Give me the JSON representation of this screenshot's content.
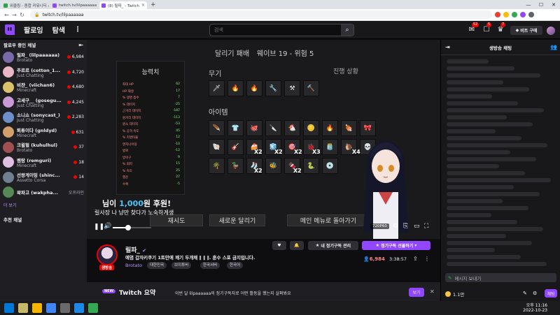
{
  "browser": {
    "tabs": [
      {
        "label": "위클링 - 종합 커뮤니티 스포티파이",
        "color": "#2ea44f"
      },
      {
        "label": "twitch.tv/lilpaaaaaa",
        "color": "#9147ff"
      },
      {
        "label": "(8) 릴파_ - Twitch",
        "color": "#9147ff",
        "active": true
      }
    ],
    "new_tab": "+",
    "url": "twitch.tv/lilpaaaaaa",
    "minimize": "—",
    "maximize": "☐",
    "close": "✕"
  },
  "nav": {
    "following": "팔로잉",
    "browse": "탐색",
    "more": "⋮",
    "search_placeholder": "검색",
    "search_icon": "⌕",
    "notif_count_1": "52",
    "notif_count_2": "5",
    "notif_count_3": "7",
    "buy_bits": "비트 구매"
  },
  "sidebar": {
    "header": "팔로우 중인 채널",
    "collapse": "⇤",
    "channels": [
      {
        "name": "릴파_ (lilpaaaaaa)",
        "game": "Brotato",
        "viewers": "6,984",
        "color": "#7a6aa8"
      },
      {
        "name": "주르르 (cotton_1...",
        "game": "Just Chatting",
        "viewers": "4,720",
        "color": "#e9b7c6"
      },
      {
        "name": "비챤_ (viichan6)",
        "game": "Minecraft",
        "viewers": "4,680",
        "color": "#d9c26a"
      },
      {
        "name": "고세구__ (gosegu...",
        "game": "Just Chatting",
        "viewers": "4,245",
        "color": "#c99ad6"
      },
      {
        "name": "소니쇼 (sonycast_)",
        "game": "Just Chatting",
        "viewers": "2,283",
        "color": "#6f8fc9"
      },
      {
        "name": "퇴튜이다 (gnldyd)",
        "game": "Minecraft",
        "viewers": "631",
        "color": "#d1a06c"
      },
      {
        "name": "크윌헐 (kuhulhul)",
        "game": "Brotato",
        "viewers": "37",
        "color": "#a05050"
      },
      {
        "name": "렘람 (remguri)",
        "game": "Minecraft",
        "viewers": "18",
        "color": "#e0c0e0"
      },
      {
        "name": "선왕게이밍 (shinc...",
        "game": "Assetto Corsa",
        "viewers": "14",
        "color": "#708090"
      },
      {
        "name": "왁파고 (wakpha...",
        "game": "",
        "viewers": "오프라인",
        "color": "#558855",
        "offline": true
      }
    ],
    "show_more": "더 보기",
    "recommended": "추천 채널"
  },
  "game": {
    "run_title": "달리기 패배",
    "wave": "웨이브 19 - 위험 5",
    "stats_title": "능력치",
    "weapons_title": "무기",
    "items_title": "아이템",
    "progress_title": "진행 상황",
    "stat_rows": [
      {
        "name": "최대 HP",
        "value": "62"
      },
      {
        "name": "HP 재생",
        "value": "17"
      },
      {
        "name": "% 생명 흡수",
        "value": "7"
      },
      {
        "name": "% 데미지",
        "value": "-25"
      },
      {
        "name": "근거리 데미지",
        "value": "-187"
      },
      {
        "name": "원거리 데미지",
        "value": "-113"
      },
      {
        "name": "원소 데미지",
        "value": "-53"
      },
      {
        "name": "% 공격 속도",
        "value": "45"
      },
      {
        "name": "% 치명타율",
        "value": "12"
      },
      {
        "name": "엔지니어링",
        "value": "-10"
      },
      {
        "name": "범위",
        "value": "-12"
      },
      {
        "name": "방어구",
        "value": "9"
      },
      {
        "name": "% 회피",
        "value": "15"
      },
      {
        "name": "% 속도",
        "value": "25"
      },
      {
        "name": "행운",
        "value": "27"
      },
      {
        "name": "수확",
        "value": "-5"
      }
    ],
    "weapons": [
      "🗡",
      "🔥",
      "🔥",
      "🔧",
      "⚒",
      "🔨"
    ],
    "items": [
      "🪶",
      "👕",
      "🐙",
      "🔪",
      "🐔",
      "🪙",
      "🔥",
      "🍖",
      "🎀",
      "🐚",
      "🎸",
      "🍰",
      "🧊",
      "🎯",
      "🐞",
      "🫙",
      "🐌",
      "💀",
      "🌴",
      "🦆",
      "🧦",
      "🐝",
      "🍫",
      "🐍",
      "💿"
    ],
    "multipliers": [
      "X2",
      "X2",
      "X2",
      "X3",
      "X4",
      "X2",
      "X2"
    ],
    "retry_button": "재시도",
    "new_run_button": "새로운 달리기",
    "main_menu_button": "메인 메뉴로 돌아가기",
    "donation_prefix": "님이 ",
    "donation_amount": "1,000",
    "donation_suffix": "원 후원!",
    "donation_message": "릴사장 나 냥만 찾다가 노숙하게생",
    "quality": "720P60",
    "player_pause": "❚❚",
    "player_volume": "🔊"
  },
  "stream": {
    "name": "릴파_",
    "verified": "✔",
    "title": "예염 갑자키쿠기 1트만에 깨기 두개채 ‖ ‖ ‖. 훈수 스포 금지입니다.",
    "game": "Brotato",
    "tags": [
      "대한민국",
      "브이튜버",
      "한국서버",
      "한국어"
    ],
    "live": "생방송",
    "viewers": "6,984",
    "uptime": "3:38:57",
    "subscribed": "내 정기구독 관리",
    "gift": "정기구독 선물하기",
    "heart": "♥",
    "bell": "🔔"
  },
  "banner": {
    "badge": "NEW",
    "title": "Twitch 요약",
    "text": "이번 달 lilpaaaaaa의 정기구독자로 어떤 활동을 했는지 살펴봐요",
    "button": "보기"
  },
  "chat": {
    "title": "생방송 채팅",
    "placeholder": "메시지 보내기",
    "send": "채팅",
    "points": "1.1만"
  },
  "taskbar": {
    "time": "오후 11:16",
    "date": "2022-10-23"
  }
}
